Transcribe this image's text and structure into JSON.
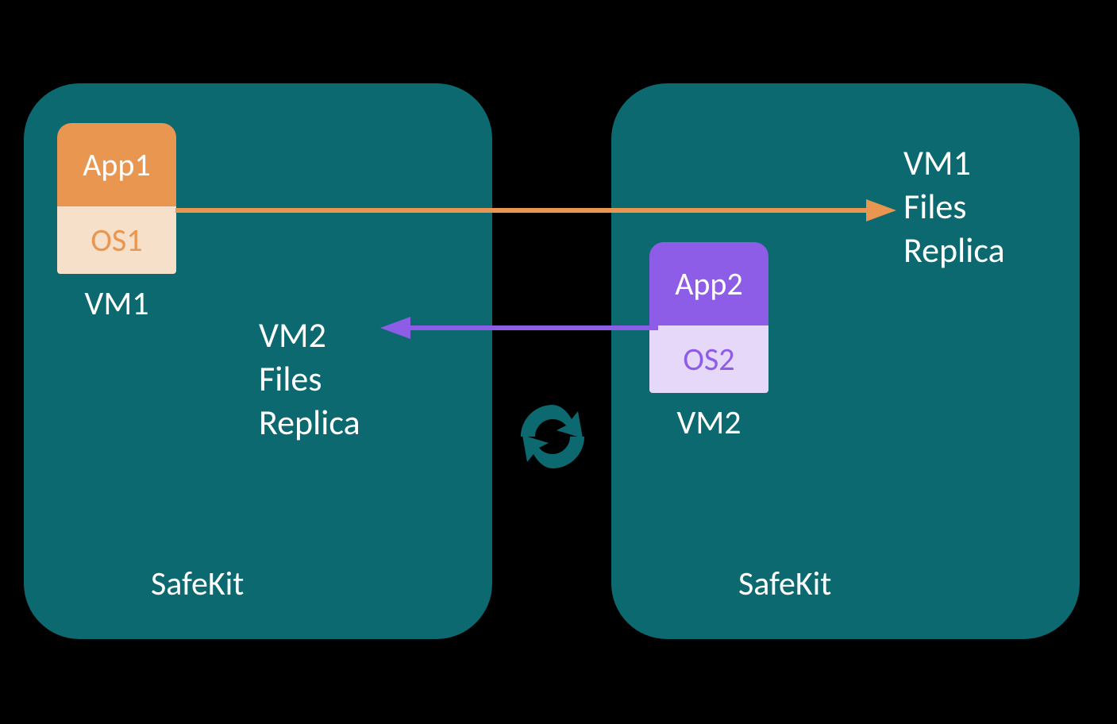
{
  "left_panel": {
    "app_label": "App1",
    "os_label": "OS1",
    "vm_label": "VM1",
    "safekit_label": "SafeKit"
  },
  "right_panel": {
    "app_label": "App2",
    "os_label": "OS2",
    "vm_label": "VM2",
    "safekit_label": "SafeKit"
  },
  "replica_left": {
    "line1": "VM2",
    "line2": "Files",
    "line3": "Replica"
  },
  "replica_right": {
    "line1": "VM1",
    "line2": "Files",
    "line3": "Replica"
  },
  "colors": {
    "panel": "#0d6970",
    "orange": "#e89650",
    "orange_light": "#f6e0ca",
    "purple": "#8e5de8",
    "purple_light": "#e6d8f8"
  }
}
